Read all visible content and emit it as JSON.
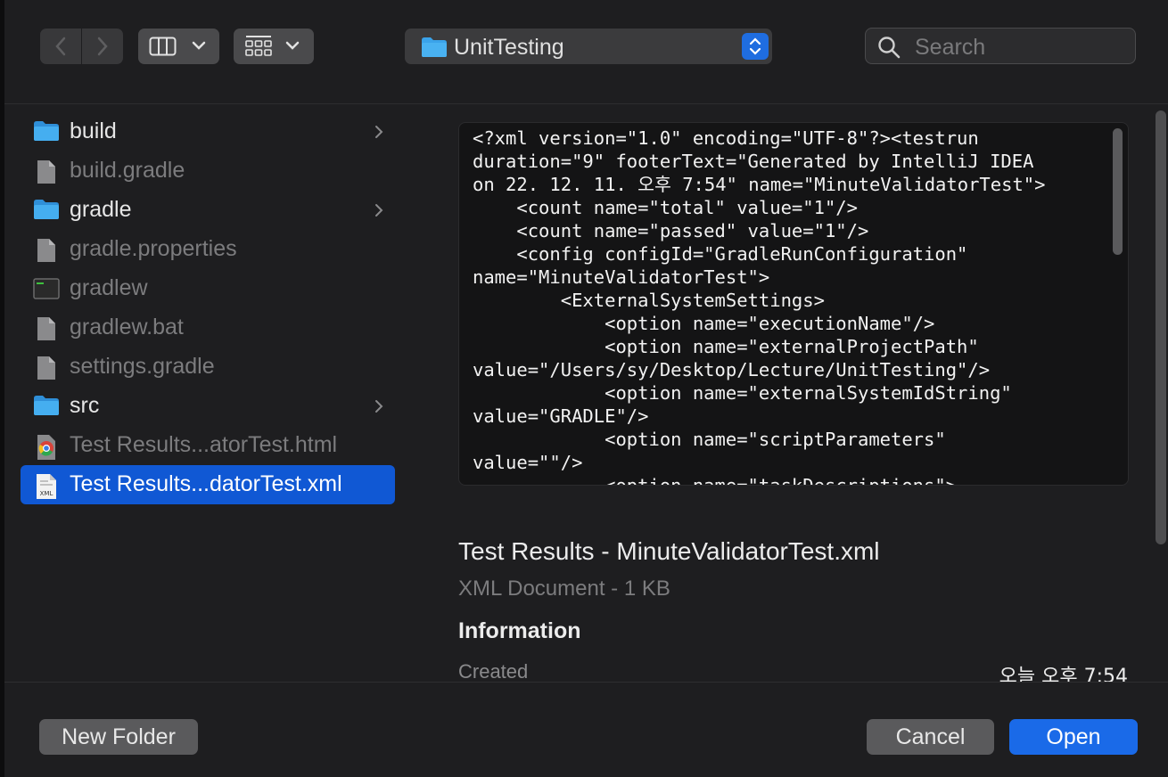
{
  "toolbar": {
    "path_label": "UnitTesting",
    "search_placeholder": "Search"
  },
  "files": [
    {
      "name": "build",
      "kind": "folder",
      "has_children": true
    },
    {
      "name": "build.gradle",
      "kind": "doc"
    },
    {
      "name": "gradle",
      "kind": "folder",
      "has_children": true
    },
    {
      "name": "gradle.properties",
      "kind": "doc"
    },
    {
      "name": "gradlew",
      "kind": "exec"
    },
    {
      "name": "gradlew.bat",
      "kind": "doc"
    },
    {
      "name": "settings.gradle",
      "kind": "doc"
    },
    {
      "name": "src",
      "kind": "folder",
      "has_children": true
    },
    {
      "name": "Test Results...atorTest.html",
      "kind": "chrome"
    },
    {
      "name": "Test Results...datorTest.xml",
      "kind": "xml",
      "selected": true
    }
  ],
  "preview": {
    "content": "<?xml version=\"1.0\" encoding=\"UTF-8\"?><testrun\nduration=\"9\" footerText=\"Generated by IntelliJ IDEA\non 22. 12. 11. 오후 7:54\" name=\"MinuteValidatorTest\">\n    <count name=\"total\" value=\"1\"/>\n    <count name=\"passed\" value=\"1\"/>\n    <config configId=\"GradleRunConfiguration\"\nname=\"MinuteValidatorTest\">\n        <ExternalSystemSettings>\n            <option name=\"executionName\"/>\n            <option name=\"externalProjectPath\"\nvalue=\"/Users/sy/Desktop/Lecture/UnitTesting\"/>\n            <option name=\"externalSystemIdString\"\nvalue=\"GRADLE\"/>\n            <option name=\"scriptParameters\"\nvalue=\"\"/>\n            <option name=\"taskDescriptions\">",
    "file_title": "Test Results - MinuteValidatorTest.xml",
    "file_subtitle": "XML Document - 1 KB",
    "info_heading": "Information",
    "created_label": "Created",
    "created_value": "오늘 오후 7:54"
  },
  "buttons": {
    "new_folder": "New Folder",
    "cancel": "Cancel",
    "open": "Open"
  },
  "colors": {
    "accent": "#1a6ae8",
    "selection": "#1058d4",
    "folder": "#3aa3ea"
  }
}
